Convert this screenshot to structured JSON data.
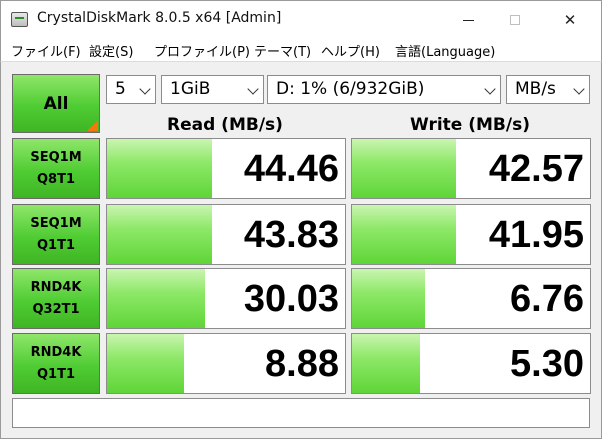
{
  "window": {
    "title": "CrystalDiskMark 8.0.5 x64 [Admin]"
  },
  "menu": [
    "ファイル(F)",
    "設定(S)",
    "プロファイル(P)",
    "テーマ(T)",
    "ヘルプ(H)",
    "言語(Language)"
  ],
  "controls": {
    "all_label": "All",
    "count": "5",
    "size": "1GiB",
    "drive": "D: 1% (6/932GiB)",
    "unit": "MB/s"
  },
  "headers": {
    "read": "Read (MB/s)",
    "write": "Write (MB/s)"
  },
  "max_scale": 44.46,
  "tests": [
    {
      "line1": "SEQ1M",
      "line2": "Q8T1",
      "read": "44.46",
      "write": "42.57"
    },
    {
      "line1": "SEQ1M",
      "line2": "Q1T1",
      "read": "43.83",
      "write": "41.95"
    },
    {
      "line1": "RND4K",
      "line2": "Q32T1",
      "read": "30.03",
      "write": "6.76"
    },
    {
      "line1": "RND4K",
      "line2": "Q1T1",
      "read": "8.88",
      "write": "5.30"
    }
  ],
  "colors": {
    "accent_green": "#4fcc33",
    "corner_orange": "#f27a0c"
  }
}
